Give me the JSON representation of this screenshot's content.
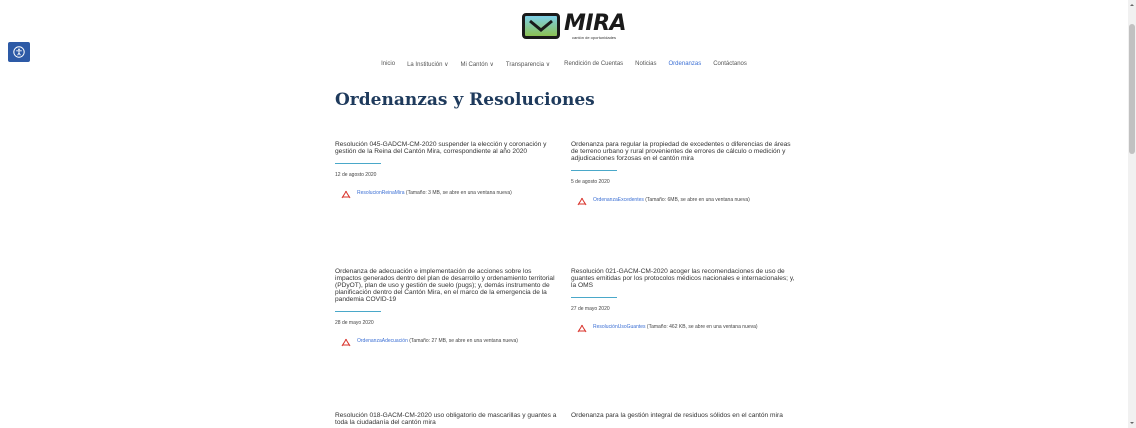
{
  "logo": {
    "word": "MIRA",
    "tagline": "cantón de oportunidades"
  },
  "nav": {
    "items": [
      {
        "label": "Inicio"
      },
      {
        "label": "La Institución ∨"
      },
      {
        "label": "Mi Cantón ∨"
      },
      {
        "label": "Transparencia ∨"
      },
      {
        "label": "Rendición de Cuentas"
      },
      {
        "label": "Noticias"
      },
      {
        "label": "Ordenanzas"
      },
      {
        "label": "Contáctanos"
      }
    ],
    "active": "Ordenanzas"
  },
  "page": {
    "title": "Ordenanzas y Resoluciones"
  },
  "cards": [
    {
      "title": "Resolución 045-GADCM-CM-2020 suspender la elección y coronación y gestión de la Reina del Cantón Mira, correspondiente al año 2020",
      "date": "12 de agosto 2020",
      "file_link": "ResolucionReinaMira",
      "file_info": " (Tamaño: 3 MB, se abre en una ventana nueva)"
    },
    {
      "title": "Ordenanza para regular la propiedad de excedentes o diferencias de áreas de terreno urbano y rural provenientes de errores de cálculo o medición y adjudicaciones forzosas en el cantón mira",
      "date": "5 de agosto 2020",
      "file_link": "OrdenanzaExcedentes",
      "file_info": " (Tamaño: 6MB, se abre en una ventana nueva)"
    },
    {
      "title": "Ordenanza de adecuación e implementación de acciones sobre los impactos generados dentro del plan de desarrollo y ordenamiento territorial (PDyOT), plan de uso y gestión de suelo (pugs); y, demás instrumento de planificación dentro del Cantón Mira, en el marco de la emergencia de la pandemia COVID-19",
      "date": "28 de mayo 2020",
      "file_link": "OrdenanzaAdecuación",
      "file_info": " (Tamaño: 27 MB, se abre en una ventana nueva)"
    },
    {
      "title": "Resolución 021-GACM-CM-2020 acoger las recomendaciones de uso de guantes emitidas por los protocolos médicos nacionales e internacionales; y, la OMS",
      "date": "27 de mayo 2020",
      "file_link": "ResoluciónUsoGuantes",
      "file_info": " (Tamaño: 462 KB, se abre en una ventana nueva)"
    },
    {
      "title": "Resolución 018-GACM-CM-2020 uso obligatorio de mascarillas y guantes a toda la ciudadanía del cantón mira"
    },
    {
      "title": "Ordenanza para la gestión integral de residuos sólidos en el cantón mira"
    }
  ],
  "colors": {
    "accent": "#3b6fd4",
    "title": "#1e3a5c",
    "rule": "#4aa8c9",
    "pdf": "#d9322a"
  },
  "icons": {
    "accessibility": "accessibility-icon",
    "file": "pdf-icon"
  }
}
